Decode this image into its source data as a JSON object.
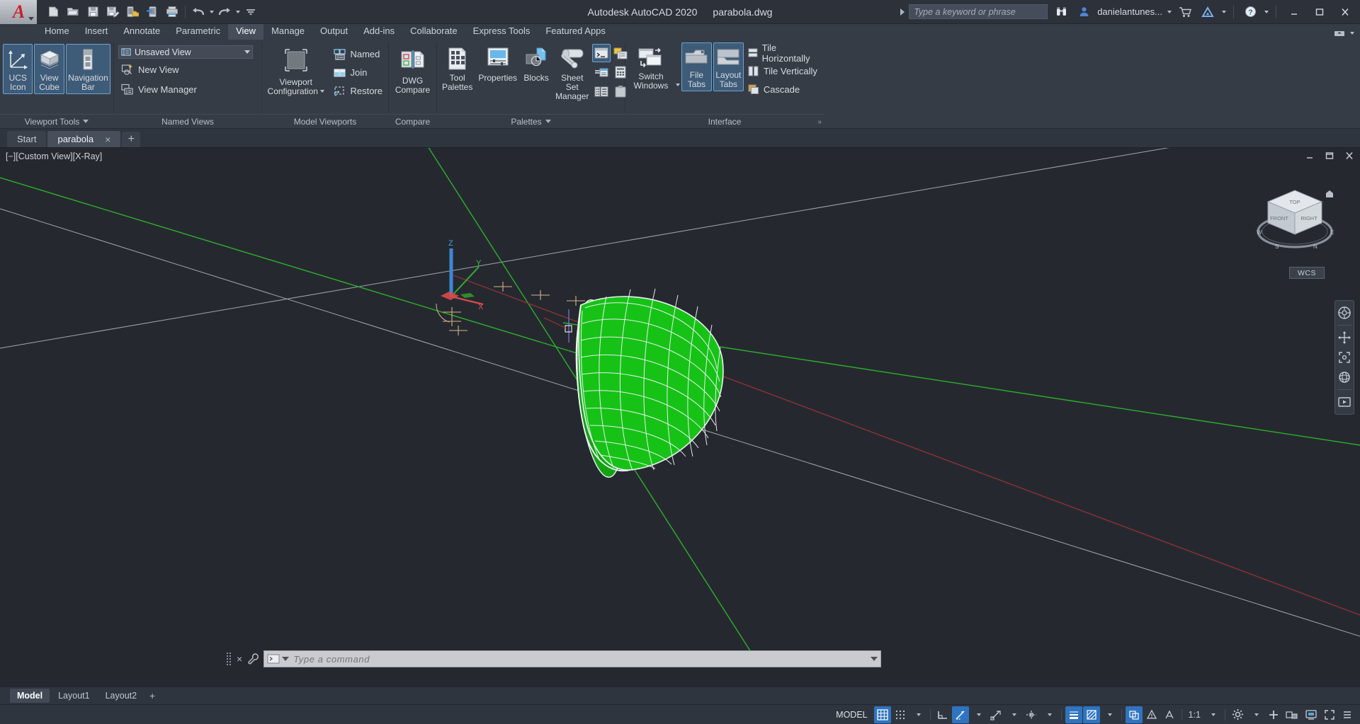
{
  "titlebar": {
    "app_title": "Autodesk AutoCAD 2020",
    "file_name": "parabola.dwg",
    "search_placeholder": "Type a keyword or phrase",
    "user_name": "danielantunes...",
    "quick_access": [
      {
        "name": "new-drawing",
        "tip": "New"
      },
      {
        "name": "open-drawing",
        "tip": "Open"
      },
      {
        "name": "save-drawing",
        "tip": "Save"
      },
      {
        "name": "save-as-drawing",
        "tip": "Save As"
      },
      {
        "name": "save-to-web-mobile",
        "tip": "Save to Web & Mobile"
      },
      {
        "name": "open-from-web-mobile",
        "tip": "Open from Web & Mobile"
      },
      {
        "name": "plot",
        "tip": "Plot"
      },
      {
        "name": "undo",
        "tip": "Undo"
      },
      {
        "name": "redo",
        "tip": "Redo"
      },
      {
        "name": "customize-qat",
        "tip": "Customize Quick Access Toolbar"
      }
    ],
    "window_buttons": [
      "minimize",
      "maximize",
      "close"
    ]
  },
  "ribbon": {
    "tabs": [
      {
        "label": "Home",
        "active": false
      },
      {
        "label": "Insert",
        "active": false
      },
      {
        "label": "Annotate",
        "active": false
      },
      {
        "label": "Parametric",
        "active": false
      },
      {
        "label": "View",
        "active": true
      },
      {
        "label": "Manage",
        "active": false
      },
      {
        "label": "Output",
        "active": false
      },
      {
        "label": "Add-ins",
        "active": false
      },
      {
        "label": "Collaborate",
        "active": false
      },
      {
        "label": "Express Tools",
        "active": false
      },
      {
        "label": "Featured Apps",
        "active": false
      }
    ],
    "panels": {
      "viewport_tools": {
        "title": "Viewport Tools",
        "has_caret": true,
        "buttons": [
          {
            "label_top": "UCS",
            "label_bottom": "Icon",
            "selected": true,
            "name": "ucs-icon-button"
          },
          {
            "label_top": "View",
            "label_bottom": "Cube",
            "selected": true,
            "name": "view-cube-button"
          },
          {
            "label_top": "Navigation",
            "label_bottom": "Bar",
            "selected": true,
            "name": "navigation-bar-button"
          }
        ]
      },
      "named_views": {
        "title": "Named Views",
        "combo_value": "Unsaved View",
        "items": [
          {
            "label": "New View",
            "name": "new-view-item"
          },
          {
            "label": "View Manager",
            "name": "view-manager-item"
          }
        ]
      },
      "model_viewports": {
        "title": "Model Viewports",
        "big_button": {
          "label_top": "Viewport",
          "label_bottom": "Configuration",
          "name": "viewport-configuration-button"
        },
        "items": [
          {
            "label": "Named",
            "name": "named-viewports-item"
          },
          {
            "label": "Join",
            "name": "join-viewports-item"
          },
          {
            "label": "Restore",
            "name": "restore-viewports-item"
          }
        ]
      },
      "compare": {
        "title": "Compare",
        "big_button": {
          "label_top": "DWG",
          "label_bottom": "Compare",
          "name": "dwg-compare-button"
        }
      },
      "palettes": {
        "title": "Palettes",
        "has_caret": true,
        "buttons": [
          {
            "label_top": "Tool",
            "label_bottom": "Palettes",
            "name": "tool-palettes-button"
          },
          {
            "label_top": "Properties",
            "label_bottom": "",
            "name": "properties-button"
          },
          {
            "label_top": "Blocks",
            "label_bottom": "",
            "name": "blocks-button"
          },
          {
            "label_top": "Sheet Set",
            "label_bottom": "Manager",
            "name": "sheet-set-manager-button"
          }
        ],
        "small_icons": [
          {
            "name": "command-line-icon",
            "selected": true
          },
          {
            "name": "quick-properties-icon",
            "selected": false
          },
          {
            "name": "external-references-icon",
            "selected": false
          },
          {
            "name": "quick-calculator-icon",
            "selected": false
          },
          {
            "name": "design-center-icon",
            "selected": false
          },
          {
            "name": "markup-set-manager-icon",
            "selected": false
          }
        ]
      },
      "interface": {
        "title": "Interface",
        "big_buttons": [
          {
            "label_top": "Switch",
            "label_bottom": "Windows",
            "selected": false,
            "name": "switch-windows-button"
          },
          {
            "label_top": "File",
            "label_bottom": "Tabs",
            "selected": true,
            "name": "file-tabs-button"
          },
          {
            "label_top": "Layout",
            "label_bottom": "Tabs",
            "selected": true,
            "name": "layout-tabs-button"
          }
        ],
        "items": [
          {
            "label": "Tile Horizontally",
            "name": "tile-horizontally-item"
          },
          {
            "label": "Tile Vertically",
            "name": "tile-vertically-item"
          },
          {
            "label": "Cascade",
            "name": "cascade-item"
          }
        ]
      }
    }
  },
  "file_tabs": [
    {
      "label": "Start",
      "active": false,
      "closable": false
    },
    {
      "label": "parabola",
      "active": true,
      "closable": true,
      "close_glyph": "×"
    }
  ],
  "file_tab_add": "+",
  "canvas": {
    "viewport_label": "[−][Custom View][X-Ray]",
    "viewport_controls": [
      "minimize",
      "restore",
      "close"
    ],
    "wcs_badge": "WCS",
    "ucs_axes": [
      {
        "name": "z-axis",
        "label": "Z",
        "color": "#4a9bea"
      },
      {
        "name": "y-axis",
        "label": "Y",
        "color": "#3fc13f"
      },
      {
        "name": "x-axis",
        "label": "X",
        "color": "#e05050"
      }
    ],
    "viewcube_faces": [
      "TOP",
      "FRONT",
      "RIGHT"
    ],
    "compass_marks": [
      "N",
      "E",
      "S",
      "W"
    ],
    "grid_line_colors": {
      "x_axis": "#a33a3a",
      "y_axis": "#2fae2f",
      "guides": "#babfc6"
    },
    "model_object": {
      "name": "parabolic-solid",
      "wire_color": "#17c217",
      "edge_color": "#e8eced"
    },
    "navbar_items": [
      {
        "name": "full-navigation-wheel-icon"
      },
      {
        "name": "pan-icon"
      },
      {
        "name": "zoom-extents-icon"
      },
      {
        "name": "orbit-icon"
      },
      {
        "name": "showmotion-icon"
      }
    ]
  },
  "command_line": {
    "placeholder": "Type a command",
    "value": "",
    "close_glyph": "×"
  },
  "layout_tabs": [
    {
      "label": "Model",
      "active": true
    },
    {
      "label": "Layout1",
      "active": false
    },
    {
      "label": "Layout2",
      "active": false
    }
  ],
  "layout_tab_add": "+",
  "status_bar": {
    "space_label": "MODEL",
    "scale_label": "1:1",
    "items": [
      {
        "name": "grid-display-toggle",
        "on": true
      },
      {
        "name": "snap-mode-toggle",
        "on": false,
        "caret": true
      },
      {
        "name": "ortho-mode-toggle",
        "on": false
      },
      {
        "name": "polar-tracking-toggle",
        "on": true,
        "caret": true
      },
      {
        "name": "object-snap-toggle",
        "on": false,
        "caret": true
      },
      {
        "name": "object-snap-tracking-toggle",
        "on": false,
        "caret": true
      },
      {
        "name": "lineweight-toggle",
        "on": true
      },
      {
        "name": "transparency-toggle",
        "on": true,
        "caret": true
      },
      {
        "name": "selection-cycling-toggle",
        "on": true
      },
      {
        "name": "annotation-monitor-toggle",
        "on": false
      },
      {
        "name": "annotation-visibility-toggle",
        "on": false
      },
      {
        "name": "annotation-scale",
        "on": false,
        "caret": true
      },
      {
        "name": "workspace-switching-gear",
        "on": false,
        "caret": true
      },
      {
        "name": "customization-plus",
        "on": false
      },
      {
        "name": "isolate-objects-icon",
        "on": false
      },
      {
        "name": "hardware-acceleration-icon",
        "on": false
      },
      {
        "name": "clean-screen-icon",
        "on": false
      },
      {
        "name": "customization-menu-icon",
        "on": false
      }
    ]
  },
  "colors": {
    "accent_blue": "#2f74c0",
    "ribbon_bg": "#363c46",
    "canvas_bg": "#25292f",
    "selected_button": "#3e5b78",
    "selected_border": "#6aa4d8",
    "logo_red": "#c8202a"
  }
}
